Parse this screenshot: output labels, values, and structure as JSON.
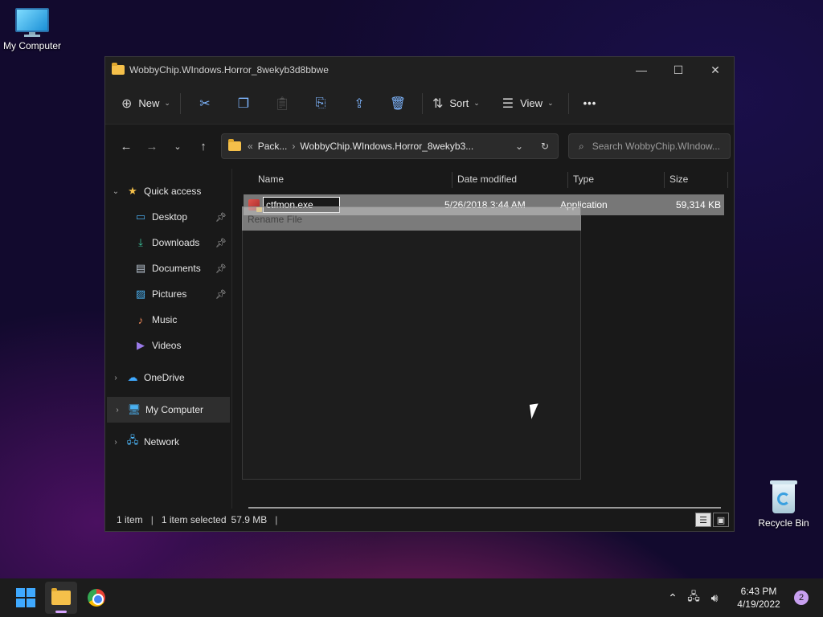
{
  "desktop": {
    "my_computer_label": "My Computer",
    "recycle_bin_label": "Recycle Bin"
  },
  "window": {
    "title": "WobbyChip.WIndows.Horror_8wekyb3d8bbwe",
    "controls": {
      "minimize": "—",
      "maximize": "☐",
      "close": "✕"
    }
  },
  "toolbar": {
    "new_label": "New",
    "sort_label": "Sort",
    "view_label": "View",
    "more_label": "•••"
  },
  "address": {
    "prefix": "«",
    "crumbs": [
      "Pack...",
      "WobbyChip.WIndows.Horror_8wekyb3..."
    ],
    "separator": "›"
  },
  "search": {
    "placeholder": "Search WobbyChip.WIndow..."
  },
  "nav_pane": {
    "quick_access": "Quick access",
    "items": [
      "Desktop",
      "Downloads",
      "Documents",
      "Pictures",
      "Music",
      "Videos"
    ],
    "onedrive": "OneDrive",
    "my_computer": "My Computer",
    "network": "Network"
  },
  "columns": {
    "name": "Name",
    "date": "Date modified",
    "type": "Type",
    "size": "Size"
  },
  "files": [
    {
      "name": "ctfmon.exe",
      "date": "5/26/2018 3:44 AM",
      "type": "Application",
      "size": "59,314 KB"
    }
  ],
  "ghost_dialog": {
    "title": "Rename File"
  },
  "status": {
    "count": "1 item",
    "selected": "1 item selected",
    "size": "57.9 MB",
    "divider": "|"
  },
  "taskbar": {
    "time": "6:43 PM",
    "date": "4/19/2022",
    "notification_count": "2"
  },
  "colors": {
    "accent": "#3fa9ff",
    "selection": "#777777",
    "window_bg": "#191919"
  }
}
